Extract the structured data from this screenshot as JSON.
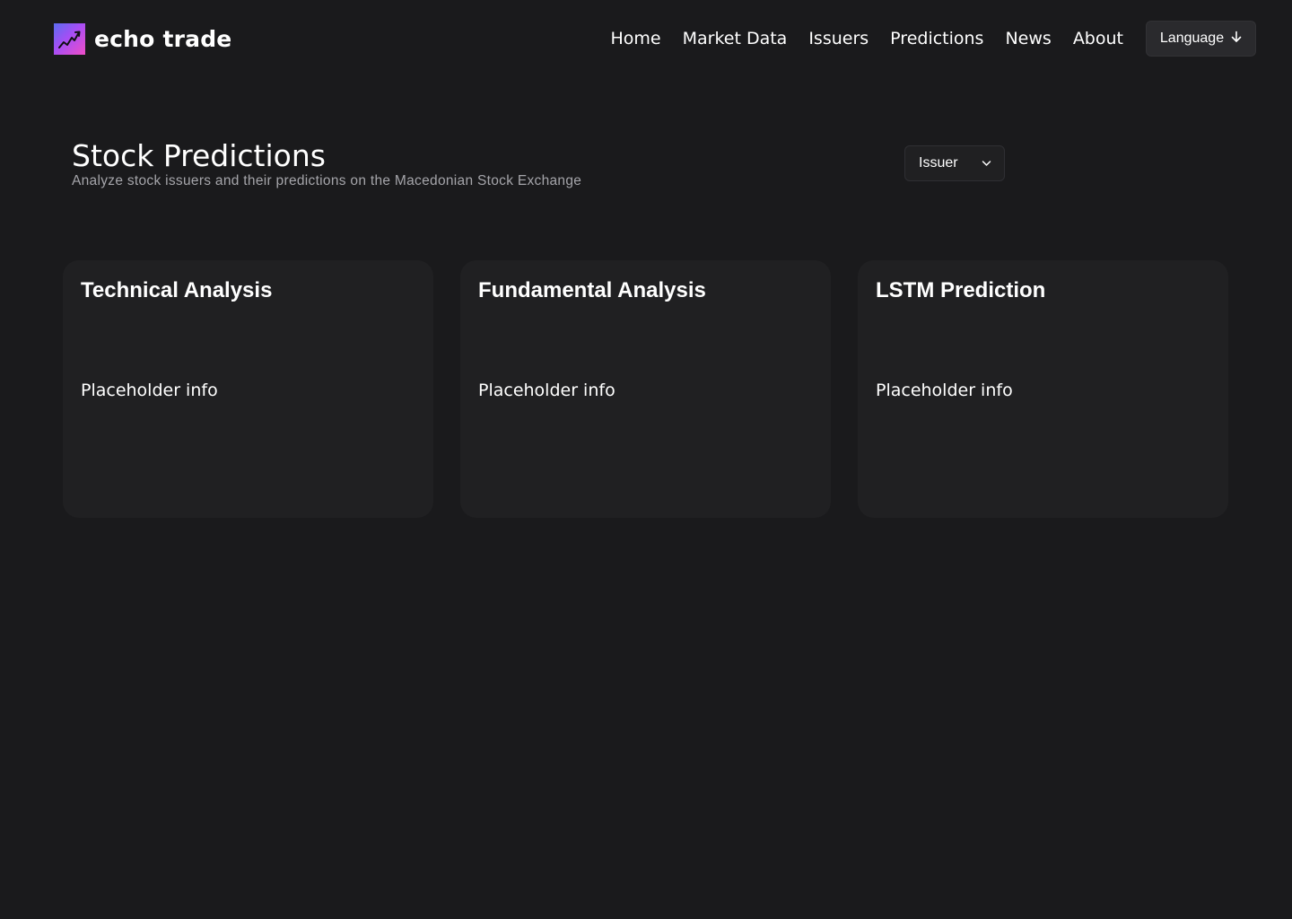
{
  "brand": {
    "name": "echo trade",
    "logo_icon": "trending-chart-icon",
    "logo_gradient": [
      "#5b6cf0",
      "#a64ef5",
      "#f04ec6"
    ]
  },
  "nav": {
    "items": [
      {
        "label": "Home"
      },
      {
        "label": "Market Data"
      },
      {
        "label": "Issuers"
      },
      {
        "label": "Predictions"
      },
      {
        "label": "News"
      },
      {
        "label": "About"
      }
    ],
    "language_button": {
      "label": "Language",
      "icon": "arrow-down-icon"
    }
  },
  "page": {
    "title": "Stock Predictions",
    "subtitle": "Analyze stock issuers and their predictions on the Macedonian Stock Exchange"
  },
  "issuer_select": {
    "selected": "Issuer",
    "icon": "chevron-down-icon"
  },
  "cards": [
    {
      "title": "Technical Analysis",
      "body": "Placeholder info"
    },
    {
      "title": "Fundamental Analysis",
      "body": "Placeholder info"
    },
    {
      "title": "LSTM Prediction",
      "body": "Placeholder info"
    }
  ],
  "colors": {
    "background": "#1a1a1c",
    "card_background": "#202022",
    "text_primary": "#ffffff",
    "text_secondary": "#a5a5aa"
  }
}
